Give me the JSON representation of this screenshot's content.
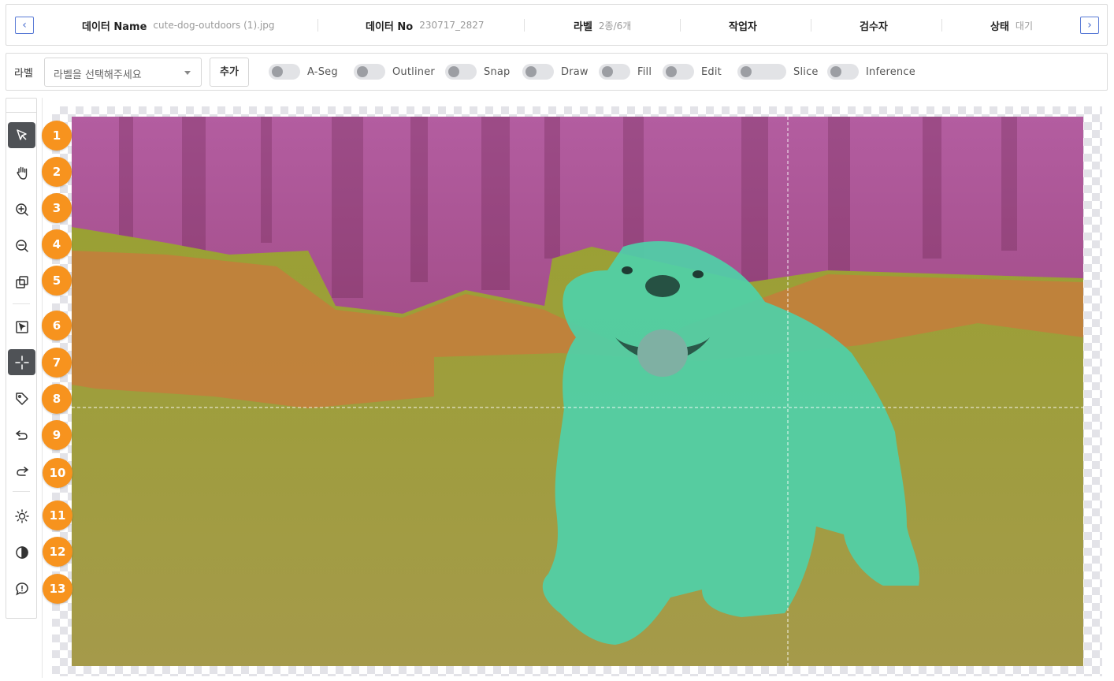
{
  "header": {
    "prev_icon": "chevron-left-icon",
    "next_icon": "chevron-right-icon",
    "prev_glyph": "‹",
    "next_glyph": "›",
    "data_name_label": "데이터 Name",
    "data_name_value": "cute-dog-outdoors (1).jpg",
    "data_no_label": "데이터 No",
    "data_no_value": "230717_2827",
    "label_label": "라벨",
    "label_value": "2종/6개",
    "worker_label": "작업자",
    "reviewer_label": "검수자",
    "status_label": "상태",
    "status_value": "대기"
  },
  "toolbar": {
    "label_text": "라벨",
    "select_placeholder": "라벨을 선택해주세요",
    "add_button": "추가",
    "toggles": [
      {
        "label": "A-Seg",
        "on": false
      },
      {
        "label": "Outliner",
        "on": false
      },
      {
        "label": "Snap",
        "on": false
      },
      {
        "label": "Draw",
        "on": false
      },
      {
        "label": "Fill",
        "on": false
      },
      {
        "label": "Edit",
        "on": false
      },
      {
        "label": "Slice",
        "on": false
      },
      {
        "label": "Inference",
        "on": false
      }
    ]
  },
  "tools": [
    {
      "name": "select-pointer-icon",
      "active": true
    },
    {
      "name": "hand-icon",
      "active": false
    },
    {
      "name": "zoom-in-icon",
      "active": false
    },
    {
      "name": "zoom-out-icon",
      "active": false
    },
    {
      "name": "copy-layers-icon",
      "active": false
    },
    {
      "name": "box-select-icon",
      "active": false
    },
    {
      "name": "crosshair-icon",
      "active": true
    },
    {
      "name": "tag-icon",
      "active": false
    },
    {
      "name": "undo-icon",
      "active": false
    },
    {
      "name": "redo-icon",
      "active": false
    },
    {
      "name": "brightness-icon",
      "active": false
    },
    {
      "name": "contrast-icon",
      "active": false
    },
    {
      "name": "alert-icon",
      "active": false
    }
  ],
  "badges": [
    "1",
    "2",
    "3",
    "4",
    "5",
    "6",
    "7",
    "8",
    "9",
    "10",
    "11",
    "12",
    "13"
  ],
  "colors": {
    "badge": "#f7931e",
    "active_tool": "#4f5256",
    "nav_accent": "#4b6fd0",
    "mask_background": "#a0407a",
    "mask_ground": "#a7a43a",
    "mask_dog": "#4fd0a8",
    "mask_midground": "#c67a3e"
  }
}
